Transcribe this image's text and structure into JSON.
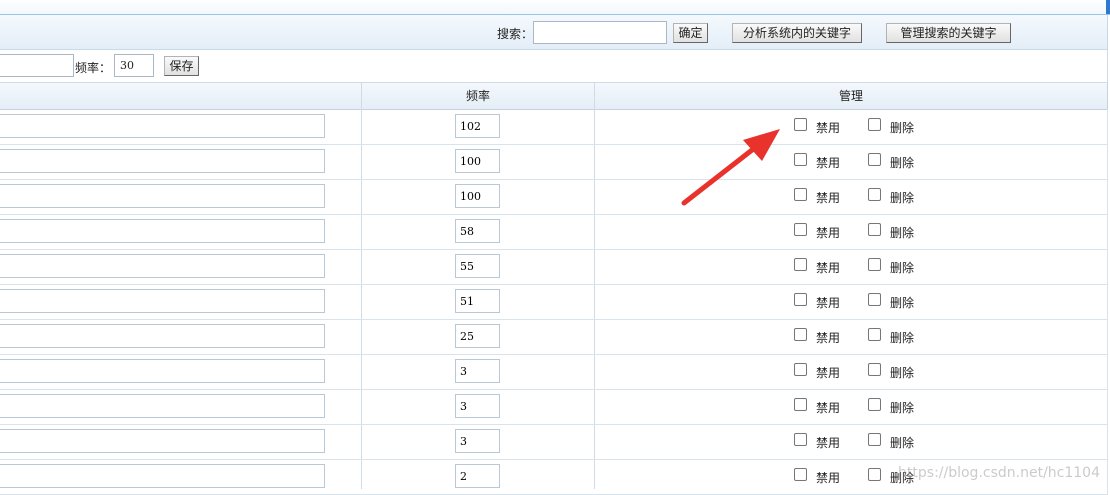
{
  "search": {
    "label": "搜索：",
    "value": "",
    "confirm_label": "确定",
    "analyze_label": "分析系统内的关键字",
    "manage_label": "管理搜索的关键字"
  },
  "save_bar": {
    "keyword_value": "",
    "frequency_label": "频率：",
    "frequency_value": "30",
    "save_label": "保存"
  },
  "table": {
    "headers": {
      "keyword": "",
      "frequency": "频率",
      "manage": "管理"
    },
    "disable_label": "禁用",
    "delete_label": "删除",
    "rows": [
      {
        "keyword": "",
        "frequency": "102"
      },
      {
        "keyword": "",
        "frequency": "100"
      },
      {
        "keyword": "",
        "frequency": "100"
      },
      {
        "keyword": "",
        "frequency": "58"
      },
      {
        "keyword": "",
        "frequency": "55"
      },
      {
        "keyword": "",
        "frequency": "51"
      },
      {
        "keyword": "",
        "frequency": "25"
      },
      {
        "keyword": "",
        "frequency": "3"
      },
      {
        "keyword": "",
        "frequency": "3"
      },
      {
        "keyword": "",
        "frequency": "3"
      },
      {
        "keyword": "",
        "frequency": "2"
      }
    ]
  },
  "annotation": {
    "arrow_color": "#e8322b",
    "icon": "red-arrow-icon"
  },
  "watermark": "https://blog.csdn.net/hc1104"
}
